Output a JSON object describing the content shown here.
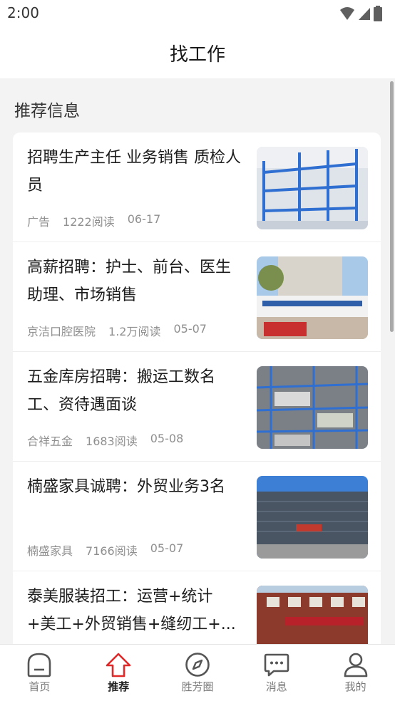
{
  "status_bar": {
    "time": "2:00"
  },
  "header": {
    "title": "找工作"
  },
  "section": {
    "title": "推荐信息"
  },
  "items": [
    {
      "title": "招聘生产主任 业务销售 质检人员",
      "source": "广告",
      "reads": "1222阅读",
      "date": "06-17",
      "thumb": "blue-shelving-photo"
    },
    {
      "title": "高薪招聘：护士、前台、医生助理、市场销售",
      "source": "京洁口腔医院",
      "reads": "1.2万阅读",
      "date": "05-07",
      "thumb": "dental-clinic-building-photo"
    },
    {
      "title": "五金库房招聘：搬运工数名工、资待遇面谈",
      "source": "合祥五金",
      "reads": "1683阅读",
      "date": "05-08",
      "thumb": "hardware-warehouse-photo"
    },
    {
      "title": "楠盛家具诚聘：外贸业务3名",
      "source": "楠盛家具",
      "reads": "7166阅读",
      "date": "05-07",
      "thumb": "glass-office-building-photo"
    },
    {
      "title": "泰美服装招工：运营+统计+美工+外贸销售+缝纫工+...",
      "source": "",
      "reads": "",
      "date": "",
      "thumb": "red-brick-building-photo"
    }
  ],
  "nav": [
    {
      "label": "首页",
      "icon": "home-icon"
    },
    {
      "label": "推荐",
      "icon": "recommend-icon"
    },
    {
      "label": "胜芳圈",
      "icon": "compass-icon"
    },
    {
      "label": "消息",
      "icon": "message-icon"
    },
    {
      "label": "我的",
      "icon": "profile-icon"
    }
  ],
  "colors": {
    "accent": "#e02a2a",
    "nav_inactive": "#555555"
  }
}
